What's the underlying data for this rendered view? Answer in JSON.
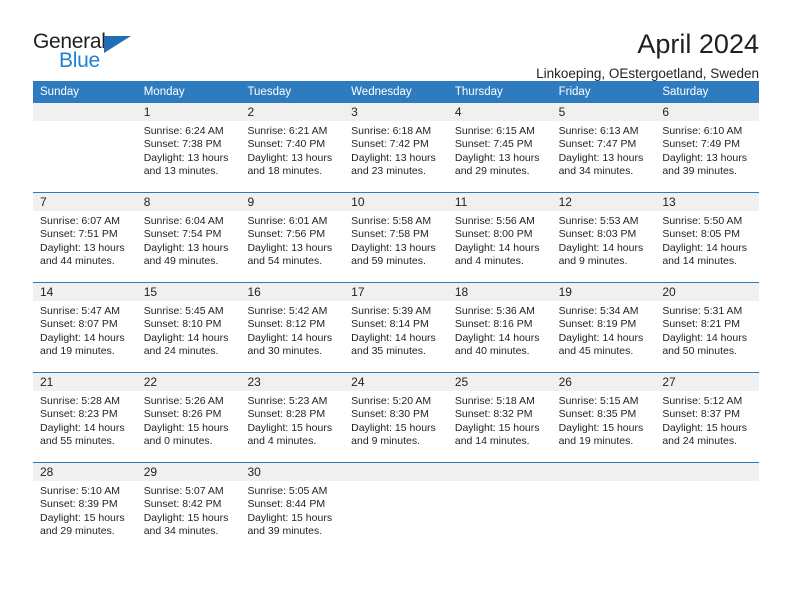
{
  "logo": {
    "word1": "General",
    "word2": "Blue",
    "triangle_color": "#1f6fb4",
    "blue_text_color": "#1f7fd0"
  },
  "header": {
    "title": "April 2024",
    "subtitle": "Linkoeping, OEstergoetland, Sweden"
  },
  "theme": {
    "header_blue": "#2e7cbf",
    "daynum_bg": "#f0f0f0",
    "text": "#231f20"
  },
  "calendar": {
    "weekdays": [
      "Sunday",
      "Monday",
      "Tuesday",
      "Wednesday",
      "Thursday",
      "Friday",
      "Saturday"
    ],
    "weeks": [
      [
        {
          "day": "",
          "sunrise": "",
          "sunset": "",
          "daylight1": "",
          "daylight2": ""
        },
        {
          "day": "1",
          "sunrise": "Sunrise: 6:24 AM",
          "sunset": "Sunset: 7:38 PM",
          "daylight1": "Daylight: 13 hours",
          "daylight2": "and 13 minutes."
        },
        {
          "day": "2",
          "sunrise": "Sunrise: 6:21 AM",
          "sunset": "Sunset: 7:40 PM",
          "daylight1": "Daylight: 13 hours",
          "daylight2": "and 18 minutes."
        },
        {
          "day": "3",
          "sunrise": "Sunrise: 6:18 AM",
          "sunset": "Sunset: 7:42 PM",
          "daylight1": "Daylight: 13 hours",
          "daylight2": "and 23 minutes."
        },
        {
          "day": "4",
          "sunrise": "Sunrise: 6:15 AM",
          "sunset": "Sunset: 7:45 PM",
          "daylight1": "Daylight: 13 hours",
          "daylight2": "and 29 minutes."
        },
        {
          "day": "5",
          "sunrise": "Sunrise: 6:13 AM",
          "sunset": "Sunset: 7:47 PM",
          "daylight1": "Daylight: 13 hours",
          "daylight2": "and 34 minutes."
        },
        {
          "day": "6",
          "sunrise": "Sunrise: 6:10 AM",
          "sunset": "Sunset: 7:49 PM",
          "daylight1": "Daylight: 13 hours",
          "daylight2": "and 39 minutes."
        }
      ],
      [
        {
          "day": "7",
          "sunrise": "Sunrise: 6:07 AM",
          "sunset": "Sunset: 7:51 PM",
          "daylight1": "Daylight: 13 hours",
          "daylight2": "and 44 minutes."
        },
        {
          "day": "8",
          "sunrise": "Sunrise: 6:04 AM",
          "sunset": "Sunset: 7:54 PM",
          "daylight1": "Daylight: 13 hours",
          "daylight2": "and 49 minutes."
        },
        {
          "day": "9",
          "sunrise": "Sunrise: 6:01 AM",
          "sunset": "Sunset: 7:56 PM",
          "daylight1": "Daylight: 13 hours",
          "daylight2": "and 54 minutes."
        },
        {
          "day": "10",
          "sunrise": "Sunrise: 5:58 AM",
          "sunset": "Sunset: 7:58 PM",
          "daylight1": "Daylight: 13 hours",
          "daylight2": "and 59 minutes."
        },
        {
          "day": "11",
          "sunrise": "Sunrise: 5:56 AM",
          "sunset": "Sunset: 8:00 PM",
          "daylight1": "Daylight: 14 hours",
          "daylight2": "and 4 minutes."
        },
        {
          "day": "12",
          "sunrise": "Sunrise: 5:53 AM",
          "sunset": "Sunset: 8:03 PM",
          "daylight1": "Daylight: 14 hours",
          "daylight2": "and 9 minutes."
        },
        {
          "day": "13",
          "sunrise": "Sunrise: 5:50 AM",
          "sunset": "Sunset: 8:05 PM",
          "daylight1": "Daylight: 14 hours",
          "daylight2": "and 14 minutes."
        }
      ],
      [
        {
          "day": "14",
          "sunrise": "Sunrise: 5:47 AM",
          "sunset": "Sunset: 8:07 PM",
          "daylight1": "Daylight: 14 hours",
          "daylight2": "and 19 minutes."
        },
        {
          "day": "15",
          "sunrise": "Sunrise: 5:45 AM",
          "sunset": "Sunset: 8:10 PM",
          "daylight1": "Daylight: 14 hours",
          "daylight2": "and 24 minutes."
        },
        {
          "day": "16",
          "sunrise": "Sunrise: 5:42 AM",
          "sunset": "Sunset: 8:12 PM",
          "daylight1": "Daylight: 14 hours",
          "daylight2": "and 30 minutes."
        },
        {
          "day": "17",
          "sunrise": "Sunrise: 5:39 AM",
          "sunset": "Sunset: 8:14 PM",
          "daylight1": "Daylight: 14 hours",
          "daylight2": "and 35 minutes."
        },
        {
          "day": "18",
          "sunrise": "Sunrise: 5:36 AM",
          "sunset": "Sunset: 8:16 PM",
          "daylight1": "Daylight: 14 hours",
          "daylight2": "and 40 minutes."
        },
        {
          "day": "19",
          "sunrise": "Sunrise: 5:34 AM",
          "sunset": "Sunset: 8:19 PM",
          "daylight1": "Daylight: 14 hours",
          "daylight2": "and 45 minutes."
        },
        {
          "day": "20",
          "sunrise": "Sunrise: 5:31 AM",
          "sunset": "Sunset: 8:21 PM",
          "daylight1": "Daylight: 14 hours",
          "daylight2": "and 50 minutes."
        }
      ],
      [
        {
          "day": "21",
          "sunrise": "Sunrise: 5:28 AM",
          "sunset": "Sunset: 8:23 PM",
          "daylight1": "Daylight: 14 hours",
          "daylight2": "and 55 minutes."
        },
        {
          "day": "22",
          "sunrise": "Sunrise: 5:26 AM",
          "sunset": "Sunset: 8:26 PM",
          "daylight1": "Daylight: 15 hours",
          "daylight2": "and 0 minutes."
        },
        {
          "day": "23",
          "sunrise": "Sunrise: 5:23 AM",
          "sunset": "Sunset: 8:28 PM",
          "daylight1": "Daylight: 15 hours",
          "daylight2": "and 4 minutes."
        },
        {
          "day": "24",
          "sunrise": "Sunrise: 5:20 AM",
          "sunset": "Sunset: 8:30 PM",
          "daylight1": "Daylight: 15 hours",
          "daylight2": "and 9 minutes."
        },
        {
          "day": "25",
          "sunrise": "Sunrise: 5:18 AM",
          "sunset": "Sunset: 8:32 PM",
          "daylight1": "Daylight: 15 hours",
          "daylight2": "and 14 minutes."
        },
        {
          "day": "26",
          "sunrise": "Sunrise: 5:15 AM",
          "sunset": "Sunset: 8:35 PM",
          "daylight1": "Daylight: 15 hours",
          "daylight2": "and 19 minutes."
        },
        {
          "day": "27",
          "sunrise": "Sunrise: 5:12 AM",
          "sunset": "Sunset: 8:37 PM",
          "daylight1": "Daylight: 15 hours",
          "daylight2": "and 24 minutes."
        }
      ],
      [
        {
          "day": "28",
          "sunrise": "Sunrise: 5:10 AM",
          "sunset": "Sunset: 8:39 PM",
          "daylight1": "Daylight: 15 hours",
          "daylight2": "and 29 minutes."
        },
        {
          "day": "29",
          "sunrise": "Sunrise: 5:07 AM",
          "sunset": "Sunset: 8:42 PM",
          "daylight1": "Daylight: 15 hours",
          "daylight2": "and 34 minutes."
        },
        {
          "day": "30",
          "sunrise": "Sunrise: 5:05 AM",
          "sunset": "Sunset: 8:44 PM",
          "daylight1": "Daylight: 15 hours",
          "daylight2": "and 39 minutes."
        },
        {
          "day": "",
          "sunrise": "",
          "sunset": "",
          "daylight1": "",
          "daylight2": ""
        },
        {
          "day": "",
          "sunrise": "",
          "sunset": "",
          "daylight1": "",
          "daylight2": ""
        },
        {
          "day": "",
          "sunrise": "",
          "sunset": "",
          "daylight1": "",
          "daylight2": ""
        },
        {
          "day": "",
          "sunrise": "",
          "sunset": "",
          "daylight1": "",
          "daylight2": ""
        }
      ]
    ]
  }
}
